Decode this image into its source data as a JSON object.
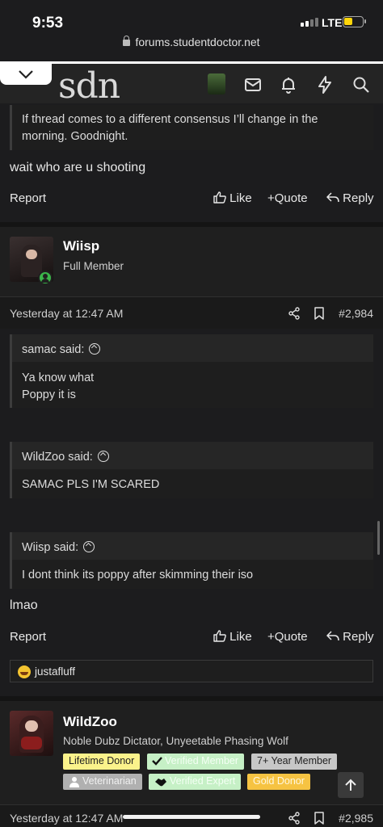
{
  "status": {
    "time": "9:53",
    "network": "LTE"
  },
  "browser": {
    "url": "forums.studentdoctor.net"
  },
  "site": {
    "logo": "sdn"
  },
  "colors": {
    "lifetime_donor": "#fbf28b",
    "verified": "#c6f0c6",
    "seven_year": "#c7c7c7",
    "veterinarian": "#b0b0b0",
    "gold": "#f6c342",
    "online": "#3bb54a"
  },
  "icons": [
    "chevron-down-icon",
    "mail-icon",
    "bell-icon",
    "bolt-icon",
    "search-icon",
    "share-icon",
    "bookmark-icon",
    "thumbs-up-icon",
    "plus-icon",
    "reply-icon",
    "arrow-up-icon",
    "checkmark-icon",
    "handshake-icon",
    "person-icon"
  ],
  "post1": {
    "quote_body": "If thread comes to a different consensus I’ll change in the morning. Goodnight.",
    "text": "wait who are u shooting",
    "actions": {
      "report": "Report",
      "like": "Like",
      "quote": "Quote",
      "reply": "Reply"
    }
  },
  "post2": {
    "username": "Wiisp",
    "user_title": "Full Member",
    "date": "Yesterday at 12:47 AM",
    "number": "#2,984",
    "quotes": [
      {
        "author": "samac said:",
        "body": [
          "Ya know what",
          "Poppy it is"
        ]
      },
      {
        "author": "WildZoo said:",
        "body": [
          "SAMAC PLS I'M SCARED"
        ]
      },
      {
        "author": "Wiisp said:",
        "body": [
          "I dont think its poppy after skimming their iso"
        ]
      }
    ],
    "text": "lmao",
    "actions": {
      "report": "Report",
      "like": "Like",
      "quote": "Quote",
      "reply": "Reply"
    },
    "reaction_user": "justafluff"
  },
  "post3": {
    "username": "WildZoo",
    "user_title": "Noble Dubz Dictator, Unyeetable Phasing Wolf",
    "badges": [
      "Lifetime Donor",
      "Verified Member",
      "7+ Year Member",
      "Veterinarian",
      "Verified Expert",
      "Gold Donor"
    ],
    "date": "Yesterday at 12:47 AM",
    "number": "#2,985"
  }
}
